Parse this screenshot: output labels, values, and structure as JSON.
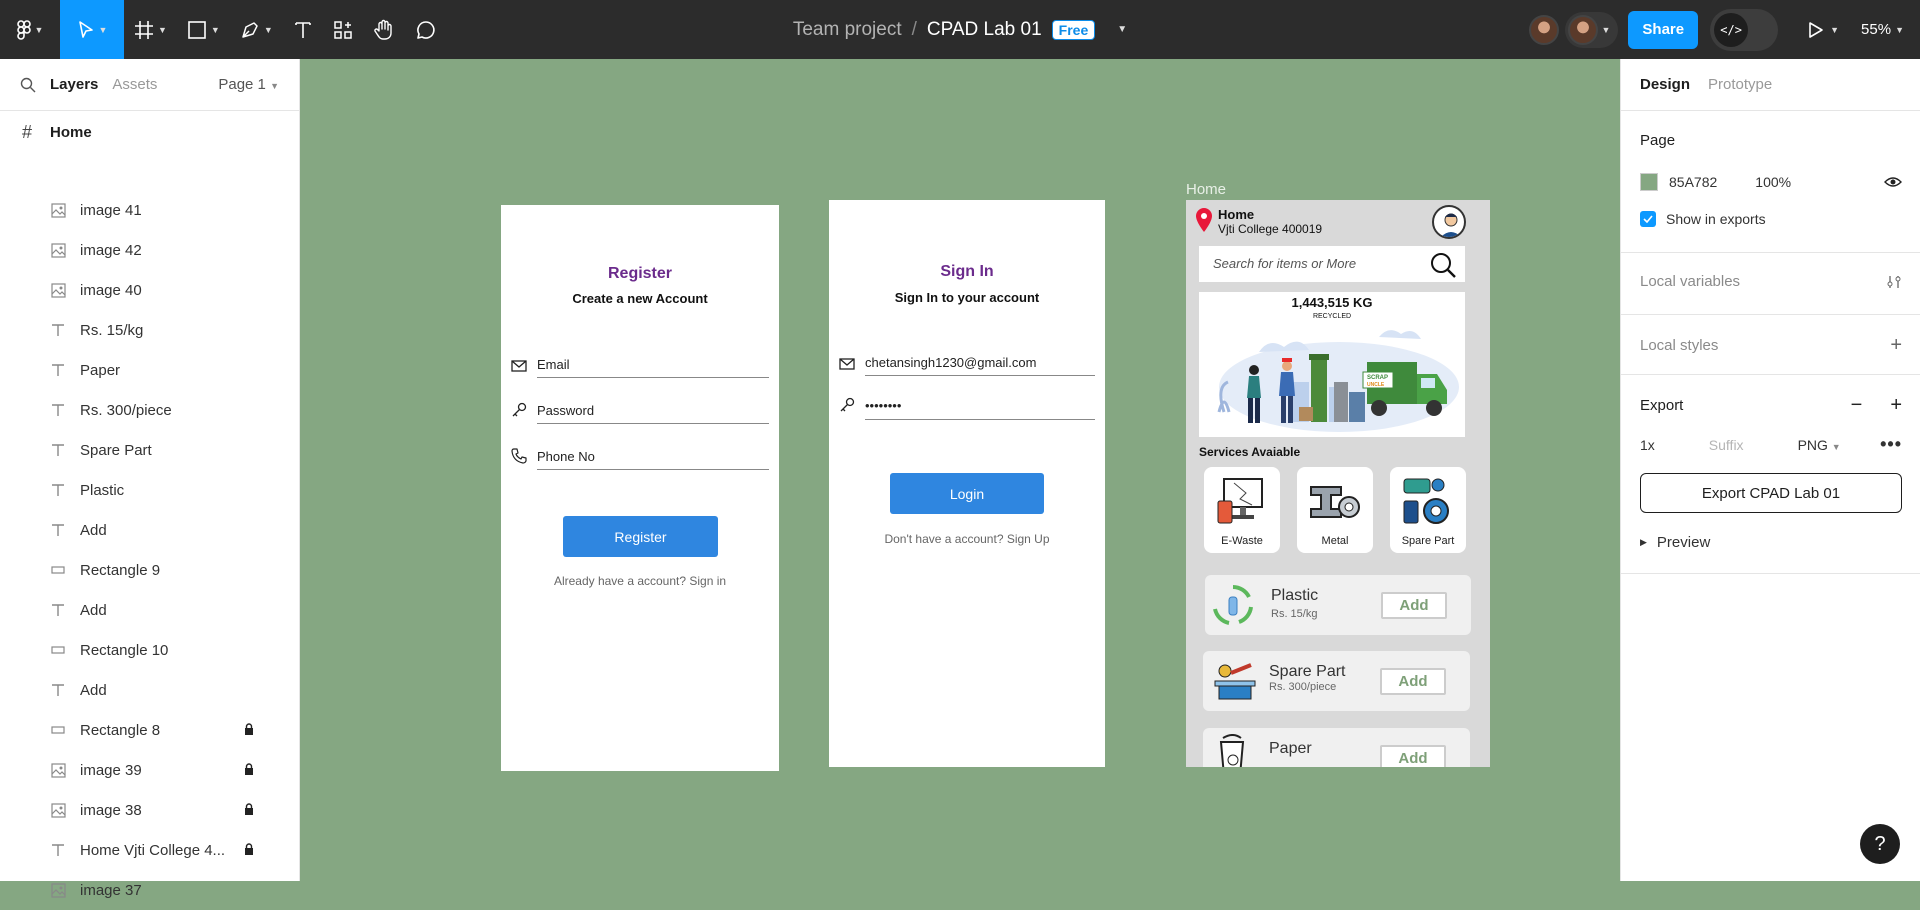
{
  "topbar": {
    "team": "Team project",
    "separator": "/",
    "file_name": "CPAD Lab 01",
    "plan_badge": "Free",
    "share_label": "Share",
    "zoom": "55%"
  },
  "left_panel": {
    "tabs": [
      "Layers",
      "Assets"
    ],
    "page_selector": "Page 1",
    "root_frame": "Home",
    "layers": [
      {
        "name": "image 41",
        "icon": "image-icon",
        "locked": false
      },
      {
        "name": "image 42",
        "icon": "image-icon",
        "locked": false
      },
      {
        "name": "image 40",
        "icon": "image-icon",
        "locked": false
      },
      {
        "name": "Rs. 15/kg",
        "icon": "text-icon",
        "locked": false
      },
      {
        "name": "Paper",
        "icon": "text-icon",
        "locked": false
      },
      {
        "name": "Rs. 300/piece",
        "icon": "text-icon",
        "locked": false
      },
      {
        "name": "Spare Part",
        "icon": "text-icon",
        "locked": false
      },
      {
        "name": "Plastic",
        "icon": "text-icon",
        "locked": false
      },
      {
        "name": "Add",
        "icon": "text-icon",
        "locked": false
      },
      {
        "name": "Rectangle 9",
        "icon": "rectangle-icon",
        "locked": false
      },
      {
        "name": "Add",
        "icon": "text-icon",
        "locked": false
      },
      {
        "name": "Rectangle 10",
        "icon": "rectangle-icon",
        "locked": false
      },
      {
        "name": "Add",
        "icon": "text-icon",
        "locked": false
      },
      {
        "name": "Rectangle 8",
        "icon": "rectangle-icon",
        "locked": true
      },
      {
        "name": "image 39",
        "icon": "image-icon",
        "locked": true
      },
      {
        "name": "image 38",
        "icon": "image-icon",
        "locked": true
      },
      {
        "name": "Home Vjti College 4...",
        "icon": "text-icon",
        "locked": true
      },
      {
        "name": "image 37",
        "icon": "image-icon",
        "locked": false
      }
    ]
  },
  "right_panel": {
    "tabs": [
      "Design",
      "Prototype"
    ],
    "page_heading": "Page",
    "page_color": "85A782",
    "page_color_hex": "#85A782",
    "page_opacity": "100%",
    "show_in_exports": "Show in exports",
    "local_variables": "Local variables",
    "local_styles": "Local styles",
    "export_heading": "Export",
    "export_scale": "1x",
    "export_suffix_placeholder": "Suffix",
    "export_format": "PNG",
    "export_button": "Export CPAD Lab 01",
    "preview": "Preview"
  },
  "canvas": {
    "background": "#85A782",
    "home_label": "Home",
    "register": {
      "title": "Register",
      "subtitle": "Create a new Account",
      "email": "Email",
      "password": "Password",
      "phone": "Phone No",
      "button": "Register",
      "link": "Already have a account? Sign in"
    },
    "signin": {
      "title": "Sign In",
      "subtitle": "Sign In to your account",
      "email_value": "chetansingh1230@gmail.com",
      "password_value": "••••••••",
      "button": "Login",
      "link": "Don't have a account? Sign Up"
    },
    "home": {
      "location_title": "Home",
      "location_sub": "Vjti College 400019",
      "search_placeholder": "Search for items or More",
      "banner_kg": "1,443,515 KG",
      "banner_recycled": "RECYCLED",
      "banner_logo_top": "SCRAP",
      "banner_logo_bottom": "UNCLE",
      "services_heading": "Services Avaiable",
      "services": [
        "E-Waste",
        "Metal",
        "Spare Part"
      ],
      "items": [
        {
          "name": "Plastic",
          "price": "Rs. 15/kg",
          "add": "Add"
        },
        {
          "name": "Spare Part",
          "price": "Rs. 300/piece",
          "add": "Add"
        },
        {
          "name": "Paper",
          "price": "",
          "add": "Add"
        }
      ]
    }
  },
  "help_label": "?"
}
